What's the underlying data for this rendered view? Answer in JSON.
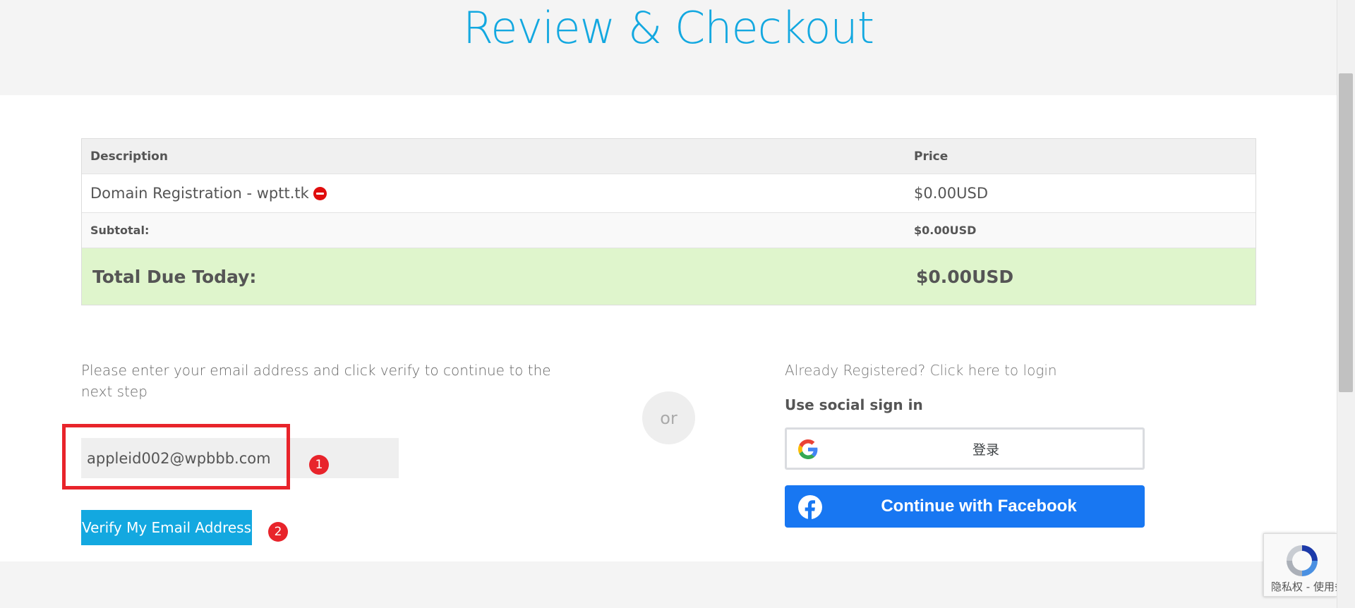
{
  "header": {
    "title": "Review & Checkout"
  },
  "table": {
    "headers": {
      "description": "Description",
      "price": "Price"
    },
    "item": {
      "description": "Domain Registration - wptt.tk",
      "price": "$0.00USD"
    },
    "subtotal": {
      "label": "Subtotal:",
      "value": "$0.00USD"
    },
    "total": {
      "label": "Total Due Today:",
      "value": "$0.00USD"
    }
  },
  "email_section": {
    "instruction": "Please enter your email address and click verify to continue to the next step",
    "email_value": "appleid002@wpbbb.com",
    "verify_label": "Verify My Email Address"
  },
  "annotations": {
    "step1": "1",
    "step2": "2"
  },
  "divider": {
    "label": "or"
  },
  "login_section": {
    "login_link": "Already Registered? Click here to login",
    "social_heading": "Use social sign in",
    "google_label": "登录",
    "facebook_label": "Continue with Facebook"
  },
  "recaptcha": {
    "text": "隐私权 - 使用条款"
  },
  "icons": {
    "remove": "remove-icon",
    "google": "google-logo-icon",
    "facebook": "facebook-logo-icon",
    "recaptcha": "recaptcha-logo-icon"
  },
  "colors": {
    "accent": "#13a8e0",
    "total_row": "#dff5cc",
    "annotation_red": "#e8242b",
    "facebook_blue": "#1877f2",
    "remove_red": "#e00d0d"
  }
}
